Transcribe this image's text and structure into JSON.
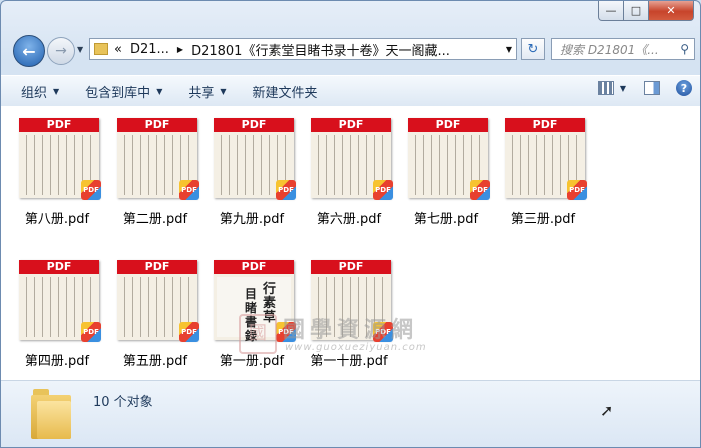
{
  "window": {
    "controls": {
      "minimize": "—",
      "maximize": "□",
      "close": "✕"
    }
  },
  "nav": {
    "back_icon": "back-arrow-icon",
    "forward_icon": "forward-arrow-icon",
    "address": {
      "prefix": "«",
      "segment1": "D21...",
      "segment2": "D21801《行素堂目睹书录十卷》天一阁藏..."
    },
    "search_placeholder": "搜索 D21801《..."
  },
  "toolbar": {
    "organize": "组织",
    "include_library": "包含到库中",
    "share": "共享",
    "new_folder": "新建文件夹"
  },
  "files": [
    {
      "name": "第八册.pdf",
      "badge": "PDF",
      "kind": "scan"
    },
    {
      "name": "第二册.pdf",
      "badge": "PDF",
      "kind": "scan"
    },
    {
      "name": "第九册.pdf",
      "badge": "PDF",
      "kind": "scan"
    },
    {
      "name": "第六册.pdf",
      "badge": "PDF",
      "kind": "scan"
    },
    {
      "name": "第七册.pdf",
      "badge": "PDF",
      "kind": "scan"
    },
    {
      "name": "第三册.pdf",
      "badge": "PDF",
      "kind": "scan"
    },
    {
      "name": "第四册.pdf",
      "badge": "PDF",
      "kind": "scan"
    },
    {
      "name": "第五册.pdf",
      "badge": "PDF",
      "kind": "scan"
    },
    {
      "name": "第一册.pdf",
      "badge": "PDF",
      "kind": "title",
      "title_text": "行素草",
      "title_text2": "目睹書録"
    },
    {
      "name": "第一十册.pdf",
      "badge": "PDF",
      "kind": "scan"
    }
  ],
  "watermark": {
    "seal": "國",
    "title": "國學資源網",
    "url": "www.guoxueziyuan.com"
  },
  "status": {
    "count": "10 个对象"
  }
}
